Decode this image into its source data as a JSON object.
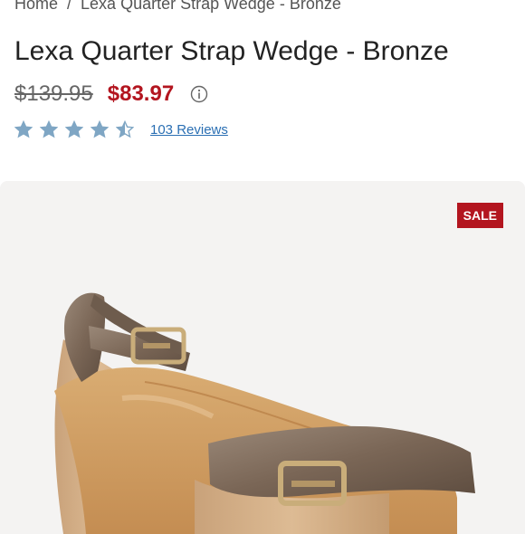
{
  "breadcrumb": {
    "home": "Home",
    "separator": "/",
    "current": "Lexa Quarter Strap Wedge - Bronze"
  },
  "product": {
    "title": "Lexa Quarter Strap Wedge - Bronze",
    "original_price": "$139.95",
    "sale_price": "$83.97",
    "rating": 4.5,
    "rating_max": 5,
    "reviews_label": "103 Reviews",
    "badge": "SALE"
  },
  "colors": {
    "sale_red": "#b3151f",
    "star_blue": "#7fa6c4",
    "link_blue": "#2a6fb3"
  },
  "icons": {
    "info": "info-icon",
    "star": "star-icon",
    "half_star": "half-star-icon"
  }
}
